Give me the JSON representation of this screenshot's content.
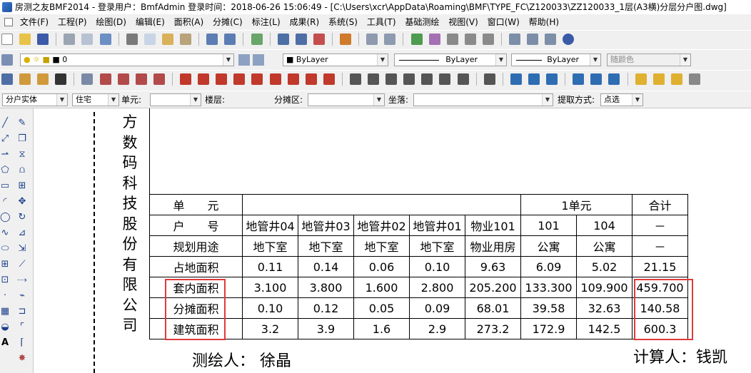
{
  "window": {
    "title": "房测之友BMF2014 - 登录用户：BmfAdmin    登录时间：2018-06-26 15:06:49 - [C:\\Users\\xcr\\AppData\\Roaming\\BMF\\TYPE_FC\\Z120033\\ZZ120033_1层(A3横)分层分户图.dwg]"
  },
  "menu": [
    "文件(F)",
    "工程(P)",
    "绘图(D)",
    "编辑(E)",
    "面积(A)",
    "分摊(C)",
    "标注(L)",
    "成果(R)",
    "系统(S)",
    "工具(T)",
    "基础测绘",
    "视图(V)",
    "窗口(W)",
    "帮助(H)"
  ],
  "layer_toolbar": {
    "layer_value": "0",
    "color_value": "ByLayer",
    "linetype_value": "ByLayer",
    "lineweight_value": "ByLayer",
    "plotstyle_value": "随颜色"
  },
  "attr_bar": {
    "mode_value": "分户实体",
    "type_value": "住宅",
    "unit_label": "单元:",
    "unit_value": "",
    "floor_label": "楼层:",
    "area_label": "分摊区:",
    "area_value": "",
    "seat_label": "坐落:",
    "seat_value": "",
    "method_label": "提取方式:",
    "method_value": "点选"
  },
  "drawing": {
    "company_vertical": [
      "方",
      "数",
      "码",
      "科",
      "技",
      "股",
      "份",
      "有",
      "限",
      "公",
      "司"
    ],
    "table": {
      "header_unit_label": "单　　元",
      "group_1": "1单元",
      "total_header": "合计",
      "row_house_label": "户　　号",
      "houses": [
        "地管井04",
        "地管井03",
        "地管井02",
        "地管井01",
        "物业101",
        "101",
        "104"
      ],
      "house_total": "－",
      "row_use_label": "规划用途",
      "uses": [
        "地下室",
        "地下室",
        "地下室",
        "地下室",
        "物业用房",
        "公寓",
        "公寓"
      ],
      "use_total": "－",
      "rows": [
        {
          "label": "占地面积",
          "values": [
            "0.11",
            "0.14",
            "0.06",
            "0.10",
            "9.63",
            "6.09",
            "5.02"
          ],
          "total": "21.15"
        },
        {
          "label": "套内面积",
          "values": [
            "3.100",
            "3.800",
            "1.600",
            "2.800",
            "205.200",
            "133.300",
            "109.900"
          ],
          "total": "459.700"
        },
        {
          "label": "分摊面积",
          "values": [
            "0.10",
            "0.12",
            "0.05",
            "0.09",
            "68.01",
            "39.58",
            "32.63"
          ],
          "total": "140.58"
        },
        {
          "label": "建筑面积",
          "values": [
            "3.2",
            "3.9",
            "1.6",
            "2.9",
            "273.2",
            "172.9",
            "142.5"
          ],
          "total": "600.3"
        }
      ]
    },
    "surveyor_label": "测绘人：",
    "surveyor_name": "徐晶",
    "calculator_label": "计算人：",
    "calculator_name": "钱凯"
  },
  "colors": {
    "highlight": "#e03a3a",
    "toolbar_bg": "#f0f0f0"
  }
}
